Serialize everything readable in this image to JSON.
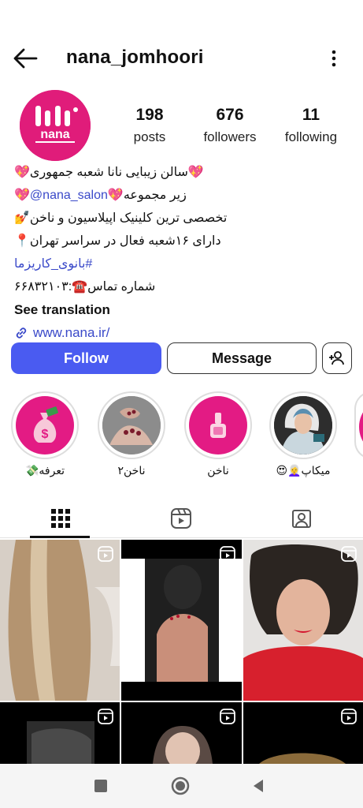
{
  "header": {
    "username": "nana_jomhoori"
  },
  "stats": {
    "posts": {
      "value": "198",
      "label": "posts"
    },
    "followers": {
      "value": "676",
      "label": "followers"
    },
    "following": {
      "value": "11",
      "label": "following"
    }
  },
  "avatar_logo_text": "nana",
  "bio": {
    "line1": "💖سالن زیبایی نانا شعبه جمهوری💖",
    "line2_prefix": "💖",
    "line2_mention": "@nana_salon",
    "line2_suffix": " زیر مجموعه💖",
    "line3": "تخصصی ترین کلینیک اپیلاسیون و ناخن💅",
    "line4": "دارای ۱۶شعبه فعال در سراسر تهران📍",
    "hashtag": "#بانوی_کاریزما",
    "phone": "شماره تماس☎️:۶۶۸۳۲۱۰۳",
    "see_translation": "See translation",
    "link": "www.nana.ir/"
  },
  "buttons": {
    "follow": "Follow",
    "message": "Message"
  },
  "highlights": [
    {
      "label": "تعرفه💸",
      "icon": "money-bag-icon"
    },
    {
      "label": "ناخن۲",
      "icon": "nails-photo"
    },
    {
      "label": "ناخن",
      "icon": "nail-polish-icon"
    },
    {
      "label": "میکاپ👩‍🦳😍",
      "icon": "makeup-photo"
    }
  ],
  "tabs": [
    "grid",
    "reels",
    "tagged"
  ],
  "colors": {
    "accent": "#4a5bf1",
    "brand": "#e01c7a",
    "link": "#3a49c9"
  }
}
